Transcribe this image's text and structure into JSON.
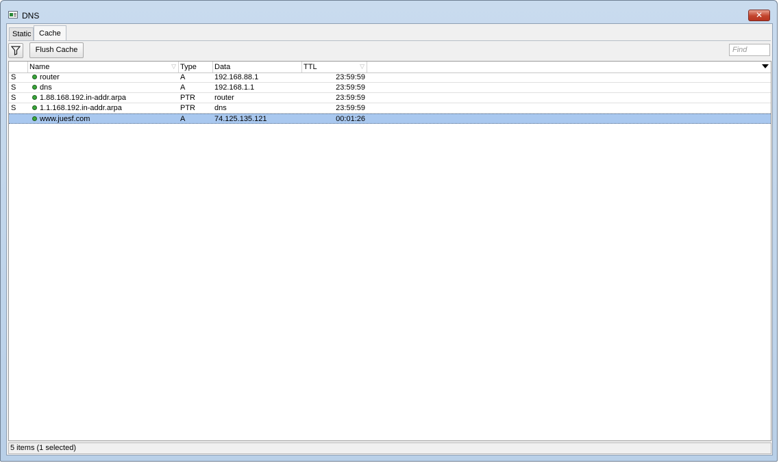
{
  "window": {
    "title": "DNS",
    "icon": "dns-window-icon",
    "close_icon": "close-icon"
  },
  "tabs": [
    {
      "label": "Static"
    },
    {
      "label": "Cache"
    }
  ],
  "active_tab": "Cache",
  "toolbar": {
    "filter_icon": "funnel-filter-icon",
    "flush_label": "Flush Cache",
    "find_placeholder": "Find"
  },
  "table": {
    "columns": [
      {
        "label": "",
        "key": "flag"
      },
      {
        "label": "Name",
        "key": "name"
      },
      {
        "label": "Type",
        "key": "type"
      },
      {
        "label": "Data",
        "key": "data"
      },
      {
        "label": "TTL",
        "key": "ttl"
      }
    ],
    "rows": [
      {
        "flag": "S",
        "name": "router",
        "type": "A",
        "data": "192.168.88.1",
        "ttl": "23:59:59",
        "selected": false
      },
      {
        "flag": "S",
        "name": "dns",
        "type": "A",
        "data": "192.168.1.1",
        "ttl": "23:59:59",
        "selected": false
      },
      {
        "flag": "S",
        "name": "1.88.168.192.in-addr.arpa",
        "type": "PTR",
        "data": "router",
        "ttl": "23:59:59",
        "selected": false
      },
      {
        "flag": "S",
        "name": "1.1.168.192.in-addr.arpa",
        "type": "PTR",
        "data": "dns",
        "ttl": "23:59:59",
        "selected": false
      },
      {
        "flag": "",
        "name": "www.juesf.com",
        "type": "A",
        "data": "74.125.135.121",
        "ttl": "00:01:26",
        "selected": true
      }
    ]
  },
  "status": {
    "text": "5 items (1 selected)"
  },
  "colors": {
    "selection": "#a9c8ef",
    "status_dot": "#39a83b",
    "close_button": "#c2442d"
  }
}
